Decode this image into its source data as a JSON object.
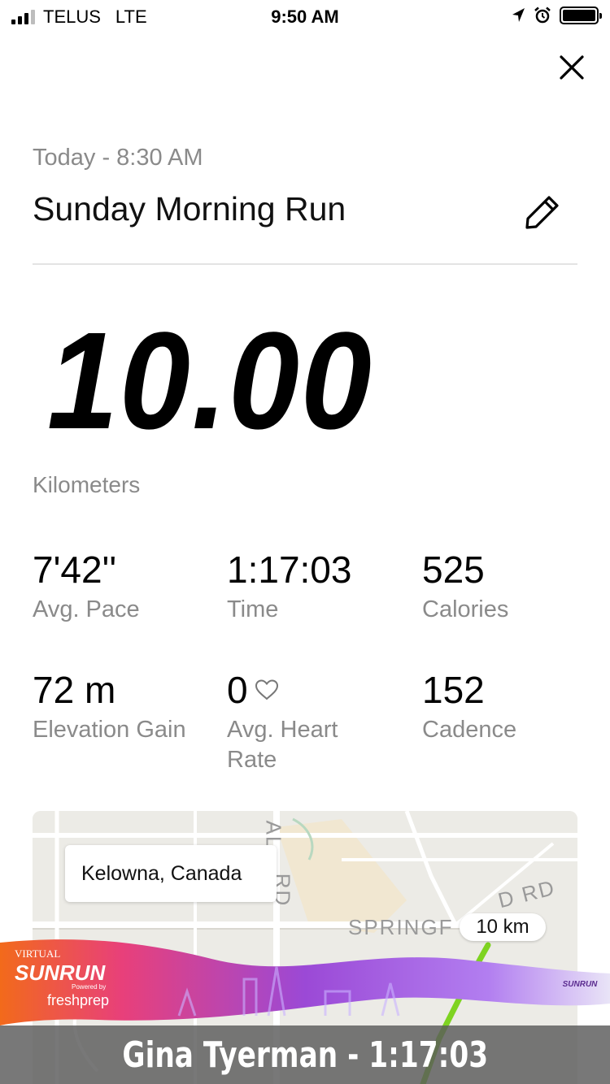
{
  "status_bar": {
    "carrier": "TELUS",
    "network": "LTE",
    "time": "9:50 AM",
    "icons": [
      "signal-icon",
      "location-arrow-icon",
      "alarm-icon",
      "battery-icon"
    ]
  },
  "header": {
    "close_icon": "close-icon",
    "date_label": "Today - 8:30 AM",
    "title": "Sunday Morning Run",
    "edit_icon": "pencil-icon"
  },
  "summary": {
    "distance": "10.00",
    "distance_unit": "Kilometers"
  },
  "stats": [
    {
      "value": "7'42''",
      "label": "Avg. Pace"
    },
    {
      "value": "1:17:03",
      "label": "Time"
    },
    {
      "value": "525",
      "label": "Calories"
    },
    {
      "value": "72 m",
      "label": "Elevation Gain"
    },
    {
      "value": "0",
      "label": "Avg. Heart Rate",
      "icon": "heart-icon"
    },
    {
      "value": "152",
      "label": "Cadence"
    }
  ],
  "map": {
    "location": "Kelowna, Canada",
    "road_labels": [
      "SPRINGF",
      "D RD",
      "AL",
      "RD",
      "RD"
    ],
    "km_marker": "10 km",
    "route_color": "#7ed321"
  },
  "banner": {
    "virtual": "VIRTUAL",
    "sunrun": "SUNRUN",
    "powered_by": "Powered by",
    "sponsor": "freshprep",
    "mini_logo": "SUNRUN",
    "caption": "Gina Tyerman - 1:17:03"
  },
  "colors": {
    "text_primary": "#111111",
    "text_secondary": "#8a8a8a",
    "divider": "#e3e3e3",
    "banner_orange": "#f26a1b",
    "banner_purple": "#8a3fd1"
  }
}
